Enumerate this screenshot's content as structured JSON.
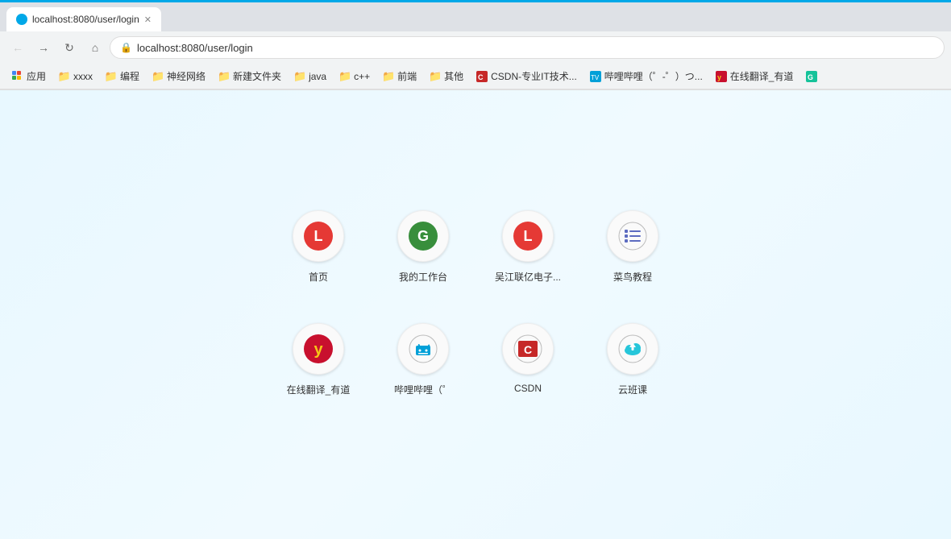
{
  "browser": {
    "tab_title": "localhost:8080/user/login",
    "address": "localhost:8080/user/login",
    "top_highlight_color": "#00a8e8"
  },
  "bookmarks": [
    {
      "id": "apps",
      "label": "应用",
      "type": "apps"
    },
    {
      "id": "xxxx",
      "label": "xxxx",
      "type": "folder"
    },
    {
      "id": "biancheng",
      "label": "编程",
      "type": "folder"
    },
    {
      "id": "shenjingwangluo",
      "label": "神经网络",
      "type": "folder"
    },
    {
      "id": "xinjianwenjian",
      "label": "新建文件夹",
      "type": "folder"
    },
    {
      "id": "java",
      "label": "java",
      "type": "folder"
    },
    {
      "id": "cpp",
      "label": "c++",
      "type": "folder"
    },
    {
      "id": "qianduan",
      "label": "前端",
      "type": "folder"
    },
    {
      "id": "qita",
      "label": "其他",
      "type": "folder"
    },
    {
      "id": "csdn",
      "label": "CSDN-专业IT技术...",
      "type": "site-csdn"
    },
    {
      "id": "bilibili",
      "label": "哔哩哔哩（゜-゜）つ...",
      "type": "site-bili"
    },
    {
      "id": "youdao",
      "label": "在线翻译_有道",
      "type": "site-youdao"
    },
    {
      "id": "grammarly",
      "label": "",
      "type": "site-g"
    }
  ],
  "shortcuts": [
    {
      "id": "homepage",
      "label": "首页",
      "icon_type": "red-l",
      "icon_text": "L"
    },
    {
      "id": "workspace",
      "label": "我的工作台",
      "icon_type": "green-g",
      "icon_text": "G"
    },
    {
      "id": "wujiang",
      "label": "吴江联亿电子...",
      "icon_type": "red-l2",
      "icon_text": "L"
    },
    {
      "id": "runoob",
      "label": "菜鸟教程",
      "icon_type": "gray-code",
      "icon_text": "code"
    },
    {
      "id": "youdao",
      "label": "在线翻译_有道",
      "icon_type": "yellow-y",
      "icon_text": "y"
    },
    {
      "id": "bilibili",
      "label": "哔哩哔哩（゜",
      "icon_type": "blue-bili",
      "icon_text": "bili"
    },
    {
      "id": "csdn",
      "label": "CSDN",
      "icon_type": "red-csdn",
      "icon_text": "C"
    },
    {
      "id": "yunban",
      "label": "云班课",
      "icon_type": "teal-cloud",
      "icon_text": "cloud"
    }
  ]
}
